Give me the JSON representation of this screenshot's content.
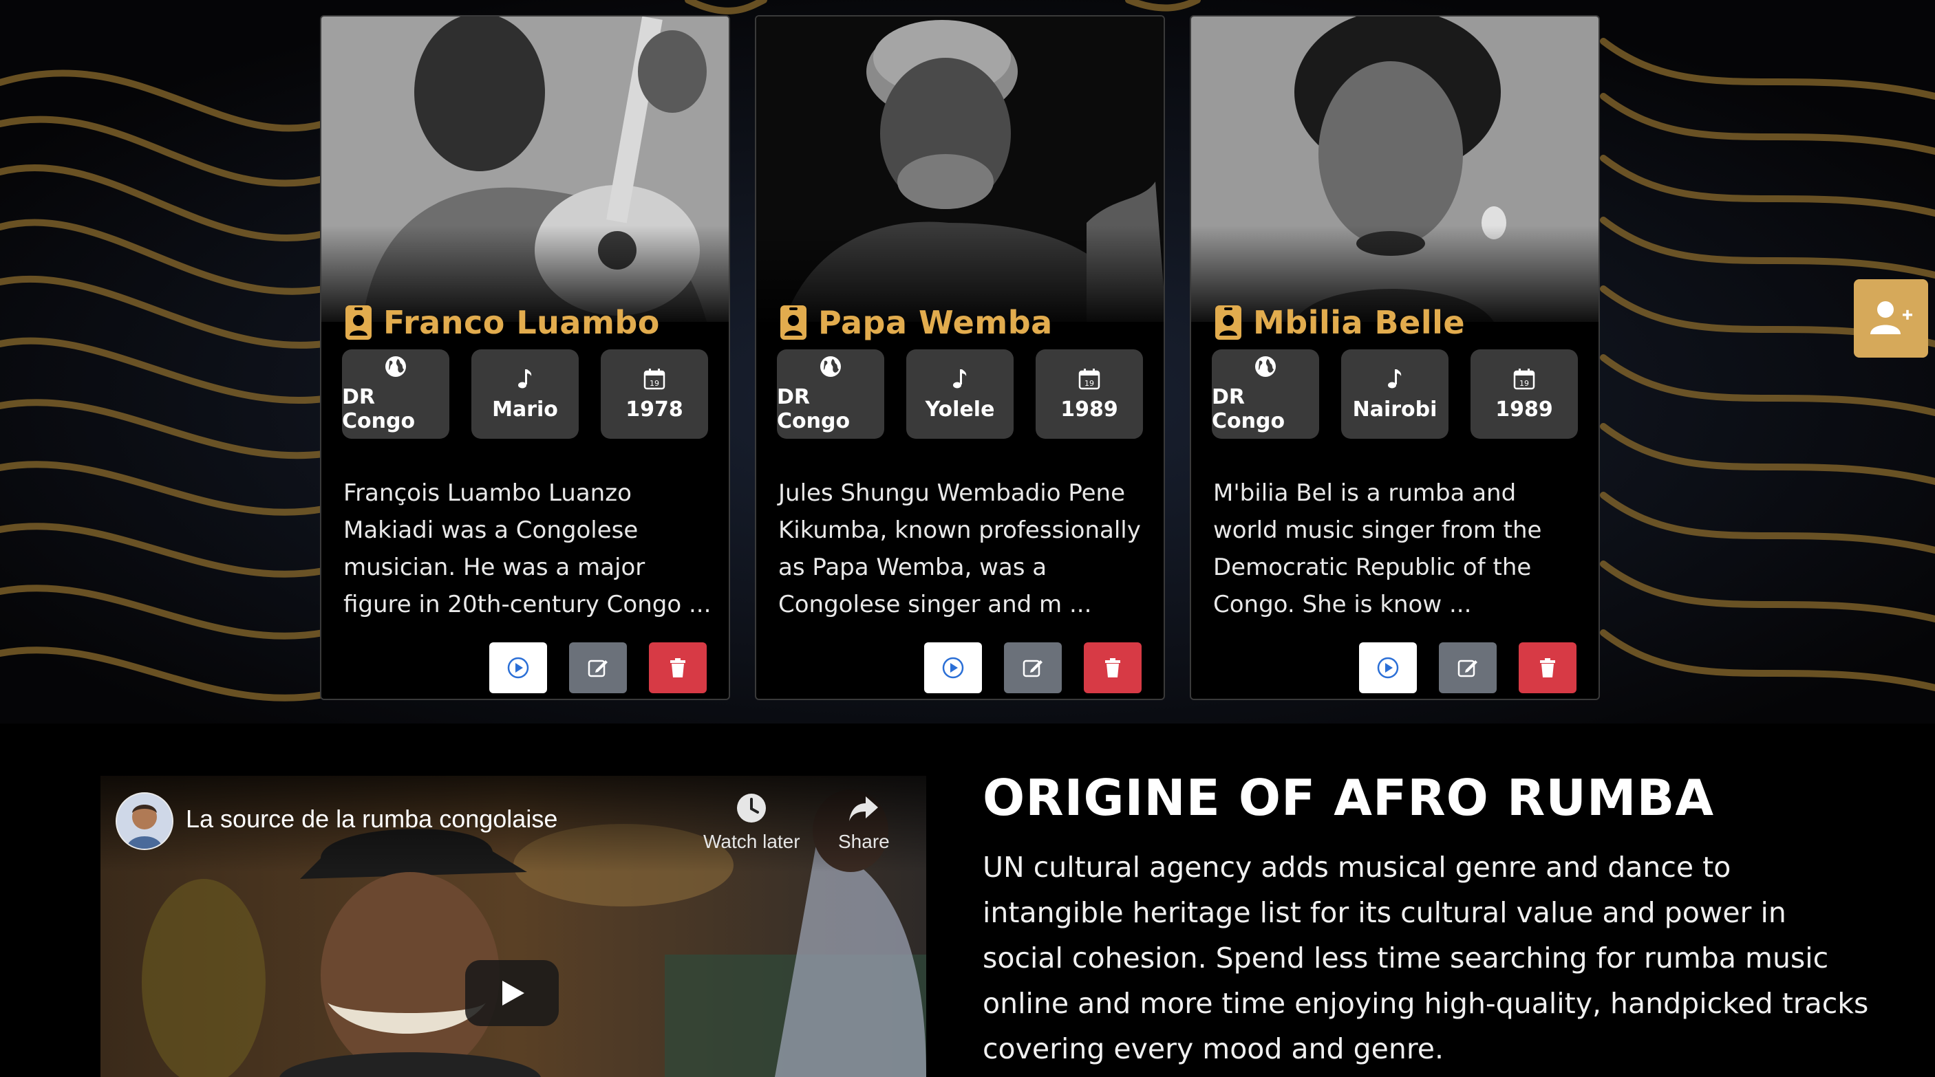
{
  "artists": [
    {
      "name": "Franco Luambo",
      "country": "DR Congo",
      "song": "Mario",
      "year": "1978",
      "description": "François Luambo Luanzo Makiadi was a Congolese musician. He was a major figure in 20th-century Congo ..."
    },
    {
      "name": "Papa Wemba",
      "country": "DR Congo",
      "song": "Yolele",
      "year": "1989",
      "description": "Jules Shungu Wembadio Pene Kikumba, known professionally as Papa Wemba, was a Congolese singer and m ..."
    },
    {
      "name": "Mbilia Belle",
      "country": "DR Congo",
      "song": "Nairobi",
      "year": "1989",
      "description": "M'bilia Bel is a rumba and world music singer from the Democratic Republic of the Congo. She is know ..."
    }
  ],
  "icons": {
    "name": "id-badge-icon",
    "country": "globe-icon",
    "song": "music-note-icon",
    "year": "calendar-icon",
    "play": "play-circle-icon",
    "edit": "edit-icon",
    "delete": "trash-icon",
    "add": "user-plus-icon"
  },
  "colors": {
    "accent_gold": "#e2ac4e",
    "chip_bg": "#3a3a3a",
    "edit_bg": "#6b717a",
    "delete_bg": "#d73a45",
    "add_user_bg": "#d6a95a"
  },
  "video": {
    "title": "La source de la rumba congolaise",
    "watch_later": "Watch later",
    "share": "Share"
  },
  "origin": {
    "title": "ORIGINE OF AFRO RUMBA",
    "body": "UN cultural agency adds musical genre and dance to intangible heritage list for its cultural value and power in social cohesion. Spend less time searching for rumba music online and more time enjoying high-quality, handpicked tracks covering every mood and genre."
  }
}
